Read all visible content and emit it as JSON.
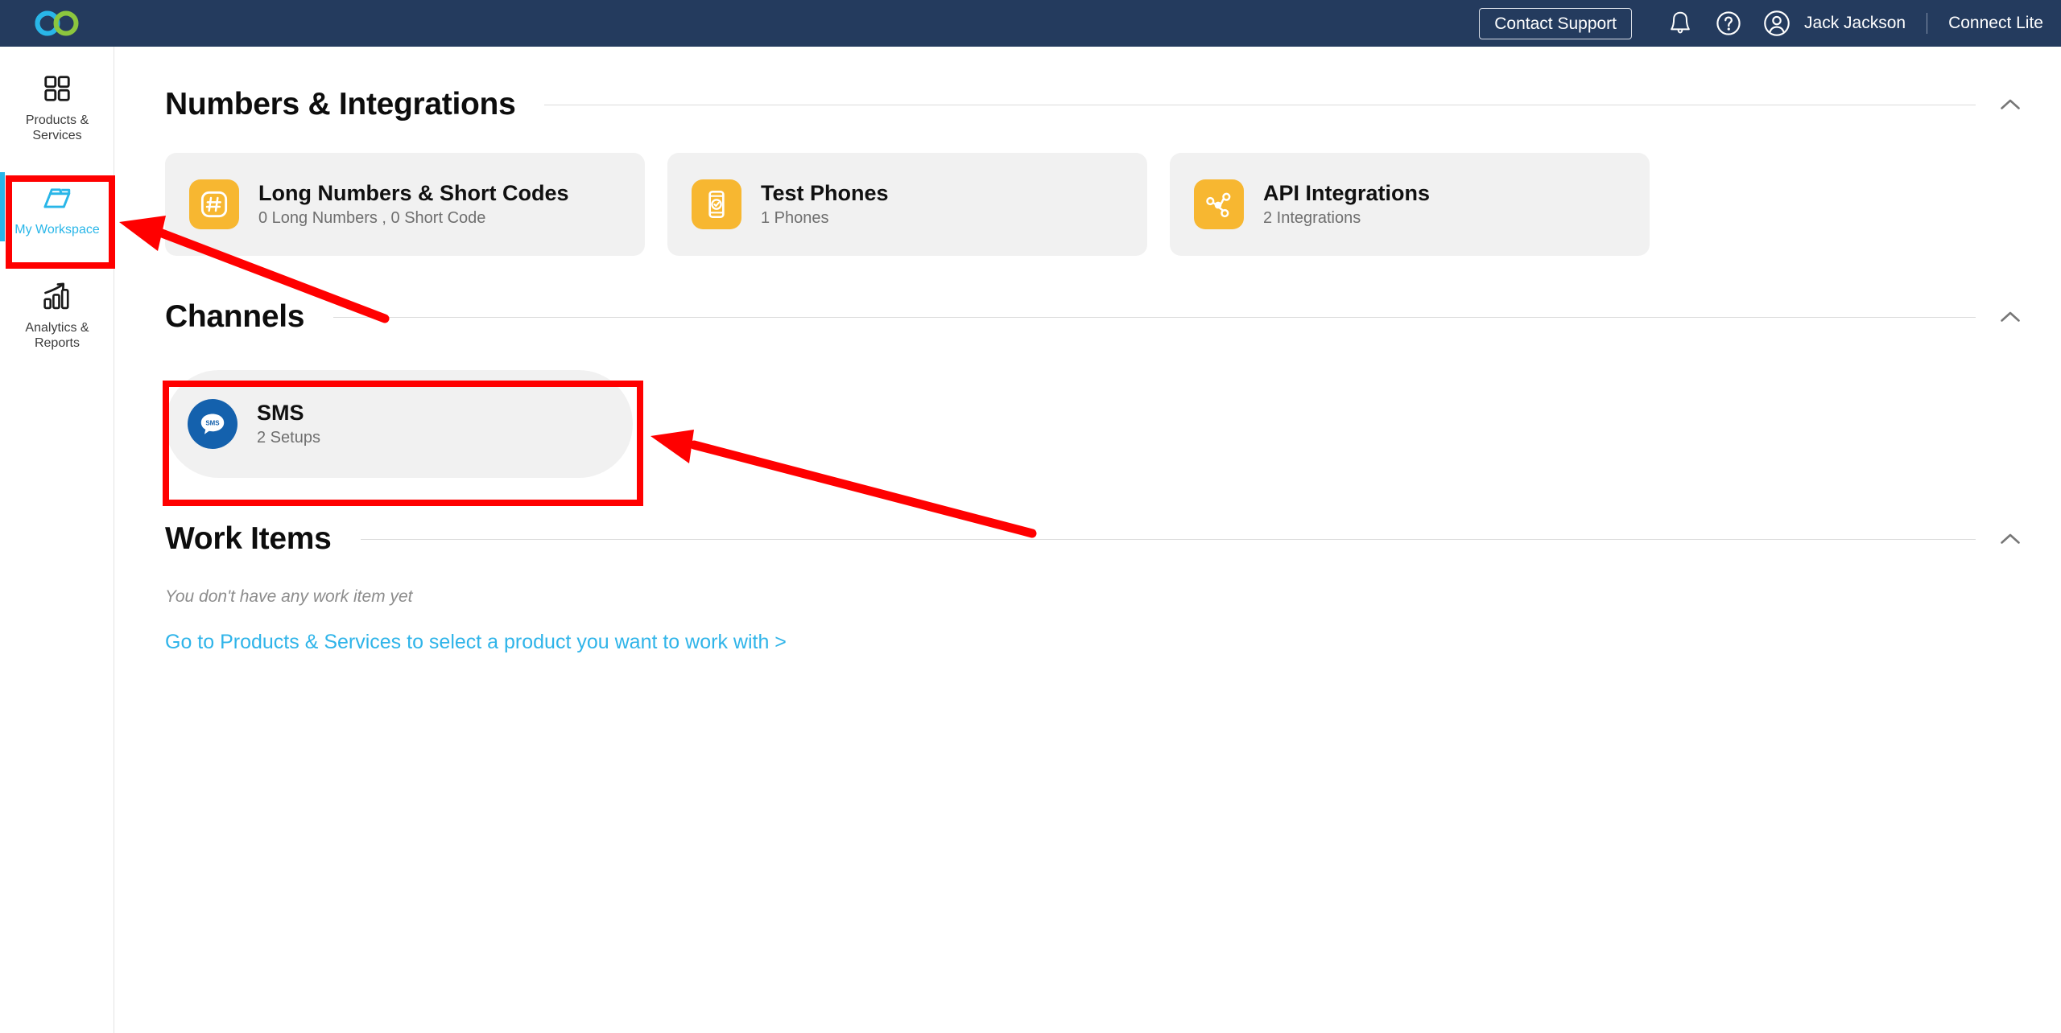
{
  "app": {
    "logo": "infinity-logo",
    "brand_blue": "#29b6e8",
    "brand_green": "#8cc63e",
    "header_bg": "#243b5e",
    "accent": "#29b6e8",
    "icon_yellow": "#f7b731",
    "sms_blue": "#1461ad",
    "annotation_red": "#ff0000"
  },
  "header": {
    "contact_support_label": "Contact Support",
    "notifications_icon": "bell-icon",
    "help_icon": "question-circle-icon",
    "avatar_icon": "user-circle-icon",
    "user_name": "Jack Jackson",
    "separator": "|",
    "plan_name": "Connect Lite"
  },
  "sidebar": {
    "items": [
      {
        "label": "Products & Services",
        "line1": "Products &",
        "line2": "Services",
        "icon": "grid-icon",
        "active": false
      },
      {
        "label": "My Workspace",
        "line1": "My Workspace",
        "line2": "",
        "icon": "folder-icon",
        "active": true
      },
      {
        "label": "Analytics & Reports",
        "line1": "Analytics &",
        "line2": "Reports",
        "icon": "bar-chart-arrow-icon",
        "active": false
      }
    ]
  },
  "sections": {
    "numbers": {
      "title": "Numbers & Integrations",
      "collapse_icon": "chevron-up-icon",
      "cards": [
        {
          "title": "Long Numbers & Short Codes",
          "subtitle": "0 Long Numbers ,  0 Short Code",
          "icon": "hash-icon"
        },
        {
          "title": "Test Phones",
          "subtitle": "1 Phones",
          "icon": "phone-check-icon"
        },
        {
          "title": "API Integrations",
          "subtitle": "2 Integrations",
          "icon": "share-nodes-icon"
        }
      ]
    },
    "channels": {
      "title": "Channels",
      "collapse_icon": "chevron-up-icon",
      "cards": [
        {
          "title": "SMS",
          "subtitle": "2 Setups",
          "icon": "sms-bubble-icon",
          "badge_text": "SMS"
        }
      ]
    },
    "work_items": {
      "title": "Work Items",
      "collapse_icon": "chevron-up-icon",
      "empty_text": "You don't have any work item yet",
      "cta_text": "Go to Products & Services to select a product you want to work with >"
    }
  },
  "annotations": {
    "highlight_boxes": [
      {
        "target": "my-workspace-sidebar-item"
      },
      {
        "target": "sms-channel-card"
      }
    ],
    "arrows": [
      {
        "from": "numbers-card-area",
        "to": "my-workspace-sidebar-item"
      },
      {
        "from": "work-items-area",
        "to": "sms-channel-card"
      }
    ]
  }
}
